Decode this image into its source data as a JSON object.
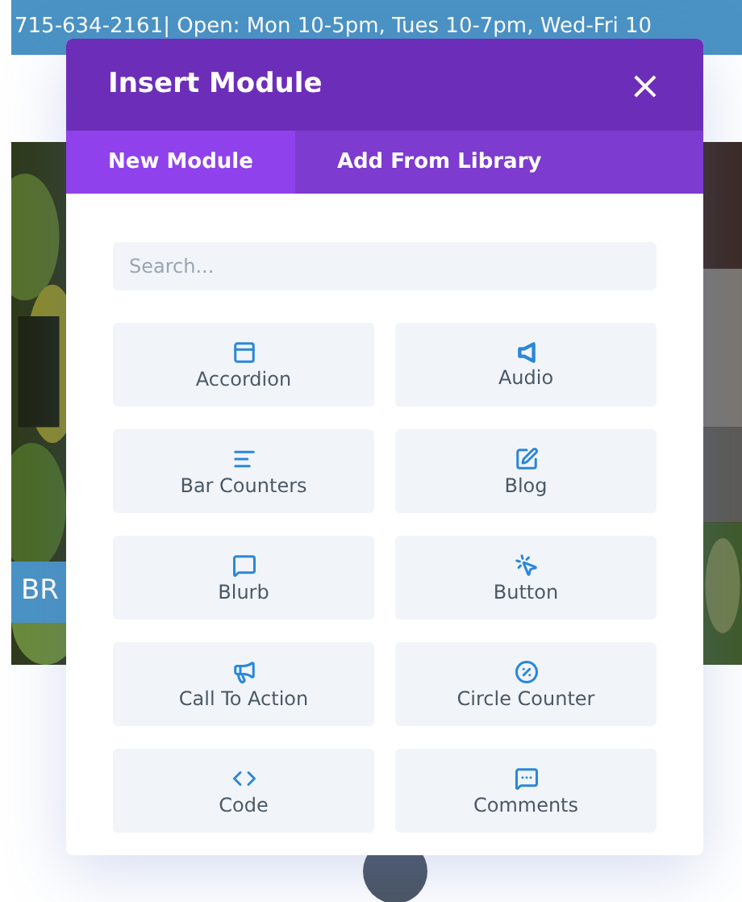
{
  "top_bar": {
    "text": "715-634-2161| Open: Mon 10-5pm, Tues 10-7pm, Wed-Fri 10"
  },
  "page_button": {
    "label": "BR"
  },
  "modal": {
    "title": "Insert Module",
    "close": "×"
  },
  "tabs": [
    {
      "label": "New Module",
      "selected": true
    },
    {
      "label": "Add From Library",
      "selected": false
    }
  ],
  "search": {
    "placeholder": "Search..."
  },
  "modules": [
    {
      "label": "Accordion",
      "kind": "accordion"
    },
    {
      "label": "Audio",
      "kind": "audio"
    },
    {
      "label": "Bar Counters",
      "kind": "bars"
    },
    {
      "label": "Blog",
      "kind": "blog"
    },
    {
      "label": "Blurb",
      "kind": "blurb"
    },
    {
      "label": "Button",
      "kind": "button"
    },
    {
      "label": "Call To Action",
      "kind": "cta"
    },
    {
      "label": "Circle Counter",
      "kind": "circle"
    },
    {
      "label": "Code",
      "kind": "code"
    },
    {
      "label": "Comments",
      "kind": "comments"
    }
  ]
}
